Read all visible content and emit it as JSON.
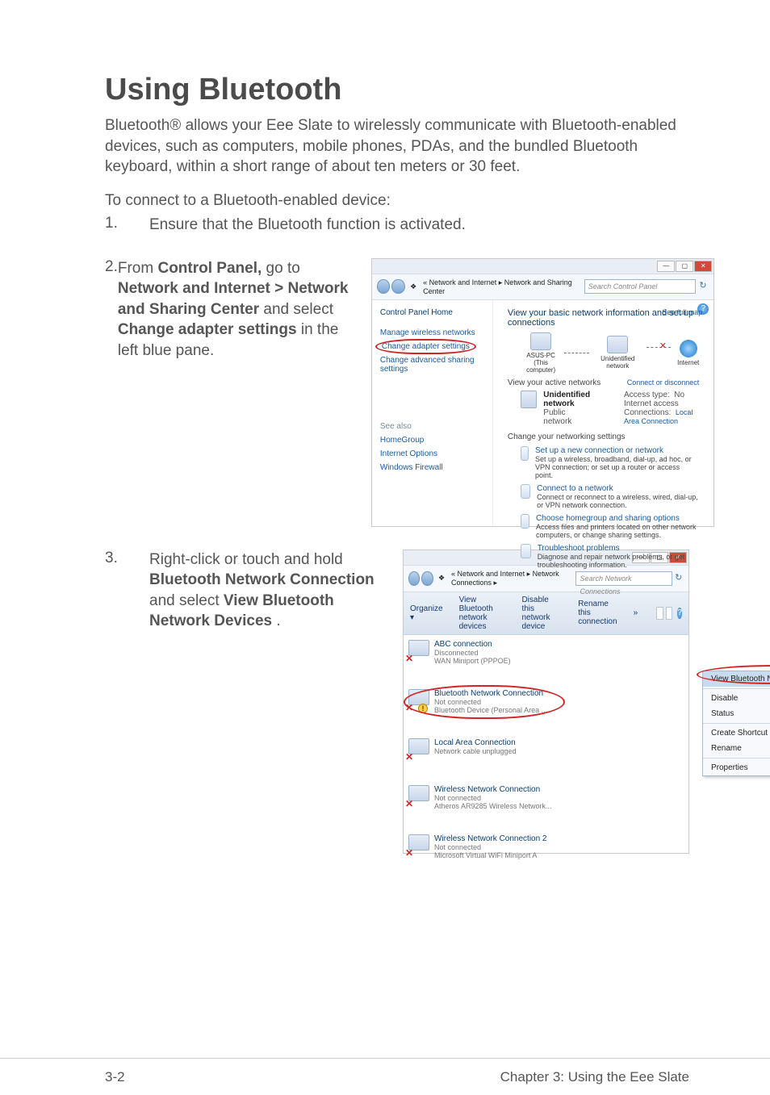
{
  "heading": "Using Bluetooth",
  "intro": "Bluetooth® allows your Eee Slate to wirelessly communicate with Bluetooth-enabled devices, such as computers, mobile phones, PDAs, and the bundled Bluetooth keyboard, within a short range of about ten meters or 30 feet.",
  "lead": "To connect to a Bluetooth-enabled device:",
  "steps": {
    "s1": {
      "num": "1.",
      "text": "Ensure that the Bluetooth function is activated."
    },
    "s2": {
      "num": "2.",
      "pre": "From ",
      "b1": "Control Panel,",
      "m1": " go to ",
      "b2": "Network and Internet > Network and Sharing Center",
      "m2": " and select ",
      "b3": "Change adapter settings",
      "m3": " in the left blue pane."
    },
    "s3": {
      "num": "3.",
      "pre": "Right-click or touch and hold ",
      "b1": "Bluetooth Network Connection",
      "m1": " and select ",
      "b2": "View Bluetooth Network Devices",
      "m2": "."
    }
  },
  "win": {
    "min": "—",
    "max": "▢",
    "close": "✕",
    "crumb_icon": "❖",
    "crumb1_a": "« Network and Internet ▸ Network and Sharing Center",
    "crumb1_b": "« Network and Internet ▸ Network Connections ▸",
    "search1": "Search Control Panel",
    "search2": "Search Network Connections",
    "refresh": "↻",
    "help": "?"
  },
  "ns": {
    "left": {
      "home": "Control Panel Home",
      "l1": "Manage wireless networks",
      "l2": "Change adapter settings",
      "l3": "Change advanced sharing settings",
      "see_also": "See also",
      "sa1": "HomeGroup",
      "sa2": "Internet Options",
      "sa3": "Windows Firewall"
    },
    "h1": "View your basic network information and set up connections",
    "full_map": "See full map",
    "node1a": "ASUS-PC",
    "node1b": "(This computer)",
    "node2": "Unidentified network",
    "node3": "Internet",
    "active_hd": "View your active networks",
    "conn_disc": "Connect or disconnect",
    "unid_b": "Unidentified network",
    "unid_s": "Public network",
    "access_l": "Access type:",
    "access_v": "No Internet access",
    "conn_l": "Connections:",
    "conn_v": "Local Area Connection",
    "chg_hd": "Change your networking settings",
    "o1t": "Set up a new connection or network",
    "o1d": "Set up a wireless, broadband, dial-up, ad hoc, or VPN connection; or set up a router or access point.",
    "o2t": "Connect to a network",
    "o2d": "Connect or reconnect to a wireless, wired, dial-up, or VPN network connection.",
    "o3t": "Choose homegroup and sharing options",
    "o3d": "Access files and printers located on other network computers, or change sharing settings.",
    "o4t": "Troubleshoot problems",
    "o4d": "Diagnose and repair network problems, or get troubleshooting information."
  },
  "nc": {
    "toolbar": {
      "org": "Organize ▾",
      "t1": "View Bluetooth network devices",
      "t2": "Disable this network device",
      "t3": "Rename this connection",
      "t4": "»"
    },
    "conns": {
      "c1n": "ABC connection",
      "c1s1": "Disconnected",
      "c1s2": "WAN Miniport (PPPOE)",
      "c2n": "Bluetooth Network Connection",
      "c2s1": "Not connected",
      "c2s2": "Bluetooth Device (Personal Area ...",
      "c3n": "Local Area Connection",
      "c3s1": "Network cable unplugged",
      "c3s2": "",
      "c4n": "Wireless Network Connection",
      "c4s1": "Not connected",
      "c4s2": "Atheros AR9285 Wireless Network...",
      "c5n": "Wireless Network Connection 2",
      "c5s1": "Not connected",
      "c5s2": "Microsoft Virtual WiFi Miniport A"
    },
    "menu": {
      "m1": "View Bluetooth Network Devices",
      "m2": "Disable",
      "m3": "Status",
      "m4": "Create Shortcut",
      "m5": "Rename",
      "m6": "Properties"
    }
  },
  "footer": {
    "left": "3-2",
    "right": "Chapter 3: Using the Eee Slate"
  }
}
